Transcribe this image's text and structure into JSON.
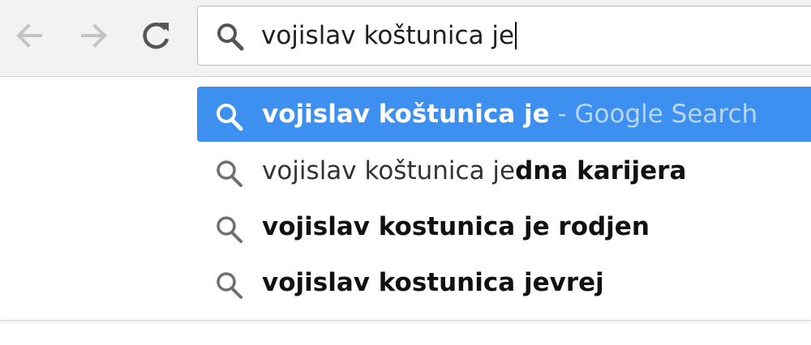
{
  "colors": {
    "toolbar_bg": "#f2f2f2",
    "selected_bg": "#3d8ff0",
    "selected_suffix": "#b9d6fb",
    "icon_gray": "#6f6f6f"
  },
  "nav": {
    "back_icon": "arrow-left-icon",
    "forward_icon": "arrow-right-icon",
    "reload_icon": "reload-icon"
  },
  "omnibox": {
    "icon": "search-icon",
    "value": "vojislav koštunica je"
  },
  "suggestions": [
    {
      "icon": "search-icon",
      "text_plain": "vojislav koštunica je",
      "text_bold": "",
      "suffix": " - Google Search",
      "selected": true
    },
    {
      "icon": "search-icon",
      "text_plain": "vojislav koštunica je",
      "text_bold": "dna karijera",
      "suffix": "",
      "selected": false
    },
    {
      "icon": "search-icon",
      "text_plain": "",
      "text_bold": "vojislav kostunica je rodjen",
      "suffix": "",
      "selected": false
    },
    {
      "icon": "search-icon",
      "text_plain": "",
      "text_bold": "vojislav kostunica jevrej",
      "suffix": "",
      "selected": false
    }
  ]
}
